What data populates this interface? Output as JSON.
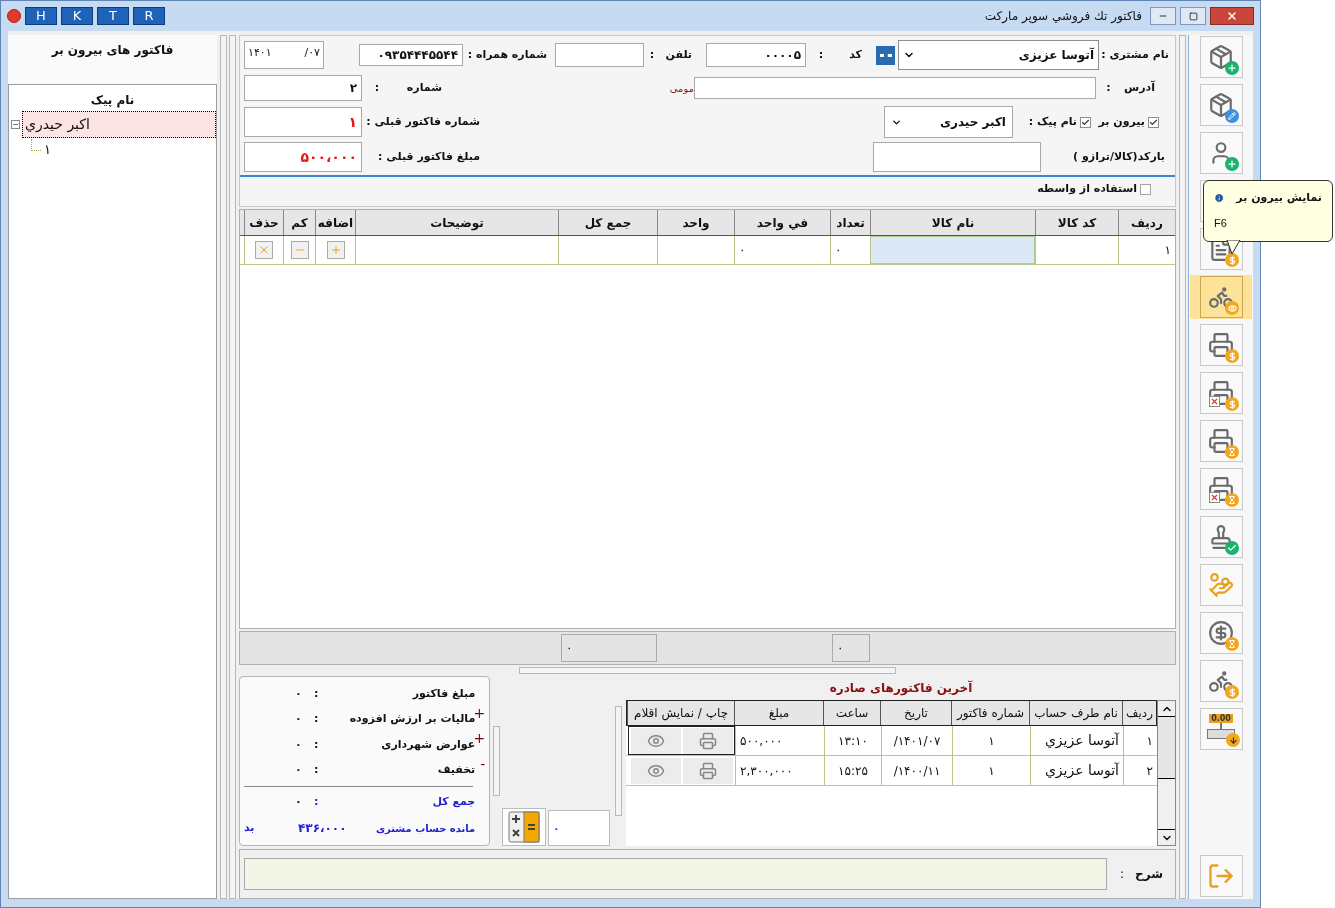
{
  "title_bar": {
    "quick_buttons": [
      "R",
      "T",
      "K",
      "H"
    ],
    "title": "فاکتور تك فروشي سوپر مارکت"
  },
  "left_panel": {
    "title": "فاکتور های بیرون بر",
    "tree_header": "نام پیک",
    "tree": [
      {
        "label": "اکبر حيدري",
        "expanded": true,
        "selected": true,
        "children": [
          {
            "label": "۱"
          }
        ]
      }
    ]
  },
  "form": {
    "customer_label": "نام مشتری :",
    "customer": "آتوسا عزیزی",
    "code_label": "کد",
    "code_colon": ":",
    "code": "۰۰۰۰۵",
    "phone_label": "تلفن",
    "phone_colon": ":",
    "mobile_label": "شماره همراه :",
    "mobile": "۰۹۳۵۴۴۴۵۵۴۴",
    "date_year": "۱۴۰۱",
    "date_month": "/۰۷",
    "address_label": "آدرس",
    "address_colon": ":",
    "address_hint": "مومی",
    "number_label": "شماره",
    "number_colon": ":",
    "number": "۲",
    "outside": {
      "label": "بیرون بر",
      "checked": true
    },
    "courier": {
      "label": "نام پیک :",
      "checked": true
    },
    "courier_name": "اکبر حیدری",
    "prev_no_label": "شماره فاکتور قبلی :",
    "prev_no": "۱",
    "barcode_label": "بارکد(کالا/ترازو )",
    "prev_amount_label": "مبلغ فاکتور قبلی :",
    "prev_amount": "۵۰۰،۰۰۰",
    "agent": {
      "label": "استفاده از واسطه",
      "checked": false
    }
  },
  "grid": {
    "columns": [
      "ردیف",
      "کد کالا",
      "نام کالا",
      "تعداد",
      "في واحد",
      "واحد",
      "جمع کل",
      "توضیحات",
      "اضافه",
      "کم",
      "حذف"
    ],
    "row": {
      "index": "۱",
      "quantity": "۰",
      "unit_price": "۰"
    },
    "totals": {
      "quantity": "۰",
      "total": "۰"
    }
  },
  "summary": {
    "rows": [
      {
        "label": "مبلغ فاکتور",
        "colon": ":",
        "value": "۰"
      },
      {
        "sign": "+",
        "label": "مالیات بر ارزش افزوده",
        "colon": ":",
        "value": "۰"
      },
      {
        "sign": "+",
        "label": "عوارض شهرداری",
        "colon": ":",
        "value": "۰"
      },
      {
        "sign": "-",
        "label": "تخفیف",
        "colon": ":",
        "value": "۰"
      }
    ],
    "total": {
      "label": "جمع کل",
      "colon": ":",
      "value": "۰"
    },
    "balance": {
      "label": "مانده حساب مشتری",
      "value": "۴۳۶،۰۰۰",
      "status": "بد"
    }
  },
  "calc_value": "۰",
  "recent": {
    "title": "آخرین فاکتورهای صادره",
    "columns": [
      "ردیف",
      "نام طرف حساب",
      "شماره فاکتور",
      "تاریخ",
      "ساعت",
      "مبلغ",
      "چاپ / نمایش اقلام"
    ],
    "rows": [
      {
        "cells": [
          "۱",
          "آتوسا عزيزي",
          "۱",
          "۱۴۰۱/۰۷/",
          "۱۳:۱۰",
          "۵۰۰,۰۰۰"
        ],
        "selected": true
      },
      {
        "cells": [
          "۲",
          "آتوسا عزيزي",
          "۱",
          "۱۴۰۰/۱۱/",
          "۱۵:۲۵",
          "۲,۳۰۰,۰۰۰"
        ],
        "selected": false
      }
    ]
  },
  "description": {
    "label": "شرح",
    "colon": ":"
  },
  "toolbar": [
    {
      "kind": "package-add",
      "selected": false
    },
    {
      "kind": "package-edit",
      "selected": false
    },
    {
      "kind": "user-add",
      "selected": false
    },
    {
      "kind": "covered",
      "selected": false
    },
    {
      "kind": "document-coin",
      "selected": false
    },
    {
      "kind": "scooter-view",
      "selected": true
    },
    {
      "kind": "printer-dollar",
      "selected": false
    },
    {
      "kind": "printer-dollar-cancel",
      "selected": false
    },
    {
      "kind": "printer-hourglass",
      "selected": false
    },
    {
      "kind": "printer-hourglass-cancel",
      "selected": false
    },
    {
      "kind": "stamp-check",
      "selected": false
    },
    {
      "kind": "hand-coin",
      "selected": false
    },
    {
      "kind": "coin-hourglass",
      "selected": false
    },
    {
      "kind": "scooter-coin",
      "selected": false
    },
    {
      "kind": "scale",
      "display": "0.00",
      "selected": false
    }
  ],
  "exit_button": {
    "kind": "exit"
  },
  "tooltip": {
    "title": "نمایش بیرون بر",
    "shortcut": "F6"
  }
}
